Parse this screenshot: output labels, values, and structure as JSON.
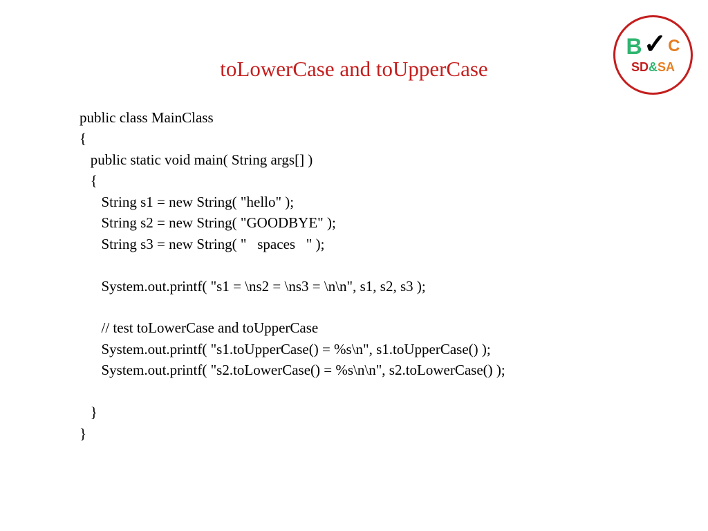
{
  "slide": {
    "title": "toLowerCase and toUpperCase",
    "code": {
      "line1": "public class MainClass",
      "line2": "{",
      "line3": "   public static void main( String args[] )",
      "line4": "   {",
      "line5": "      String s1 = new String( \"hello\" );",
      "line6": "      String s2 = new String( \"GOODBYE\" );",
      "line7": "      String s3 = new String( \"   spaces   \" );",
      "line8": "",
      "line9": "      System.out.printf( \"s1 = \\ns2 = \\ns3 = \\n\\n\", s1, s2, s3 );",
      "line10": "",
      "line11": "      // test toLowerCase and toUpperCase",
      "line12": "      System.out.printf( \"s1.toUpperCase() = %s\\n\", s1.toUpperCase() );",
      "line13": "      System.out.printf( \"s2.toLowerCase() = %s\\n\\n\", s2.toLowerCase() );",
      "line14": "",
      "line15": "   }",
      "line16": "}"
    },
    "logo": {
      "b": "B",
      "c": "C",
      "sd": "SD",
      "amp": "&",
      "sa": "SA"
    }
  }
}
